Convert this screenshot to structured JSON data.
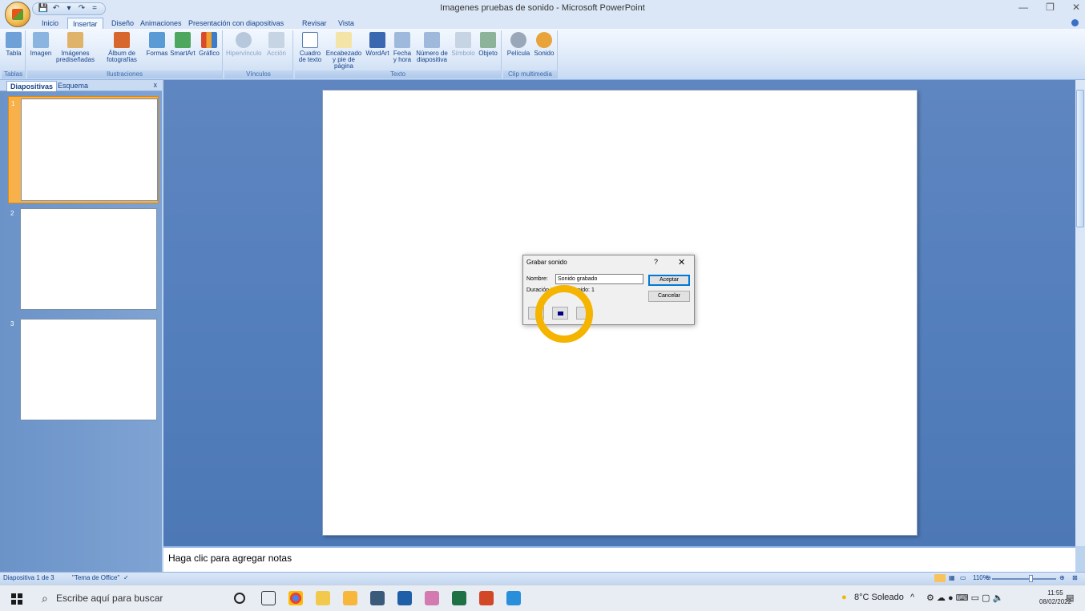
{
  "app": {
    "title": "Imagenes pruebas de sonido - Microsoft PowerPoint",
    "window_controls": [
      "—",
      "❐",
      "✕"
    ]
  },
  "qat": [
    "💾",
    "↶",
    "▾",
    "↷",
    "="
  ],
  "tabs": [
    "Inicio",
    "Insertar",
    "Diseño",
    "Animaciones",
    "Presentación con diapositivas",
    "Revisar",
    "Vista"
  ],
  "active_tab": "Insertar",
  "ribbon": {
    "groups": [
      {
        "label": "Tablas"
      },
      {
        "label": "Ilustraciones"
      },
      {
        "label": "Vínculos"
      },
      {
        "label": "Texto"
      },
      {
        "label": "Clip multimedia"
      }
    ],
    "buttons": {
      "tabla": "Tabla",
      "imagen": "Imagen",
      "imagenes_pred": "Imágenes prediseñadas",
      "album": "Álbum de fotografías",
      "formas": "Formas",
      "smartart": "SmartArt",
      "grafico": "Gráfico",
      "hipervinculo": "Hipervínculo",
      "accion": "Acción",
      "cuadro_texto": "Cuadro de texto",
      "encabezado": "Encabezado y pie de página",
      "wordart": "WordArt",
      "fecha": "Fecha y hora",
      "numero": "Número de diapositiva",
      "simbolo": "Símbolo",
      "objeto": "Objeto",
      "pelicula": "Película",
      "sonido": "Sonido"
    }
  },
  "panel": {
    "tabs": [
      "Diapositivas",
      "Esquema"
    ],
    "close": "x",
    "slides": [
      "1",
      "2",
      "3"
    ]
  },
  "notes_placeholder": "Haga clic para agregar notas",
  "dialog": {
    "title": "Grabar sonido",
    "help": "?",
    "close": "✕",
    "name_label": "Nombre:",
    "name_value": "Sonido grabado",
    "duration_label": "Duración total del sonido:",
    "duration_value": "1",
    "ok": "Aceptar",
    "cancel": "Cancelar"
  },
  "status": {
    "slide_info": "Diapositiva 1 de 3",
    "theme": "\"Tema de Office\"",
    "zoom": "110%"
  },
  "taskbar": {
    "search_placeholder": "Escribe aquí para buscar",
    "weather": "8°C Soleado",
    "time": "11:55",
    "date": "08/02/2022"
  },
  "colors": {
    "highlight": "#f4b400",
    "ribbon_bg": "#dde9f8",
    "workspace": "#547fbd"
  }
}
